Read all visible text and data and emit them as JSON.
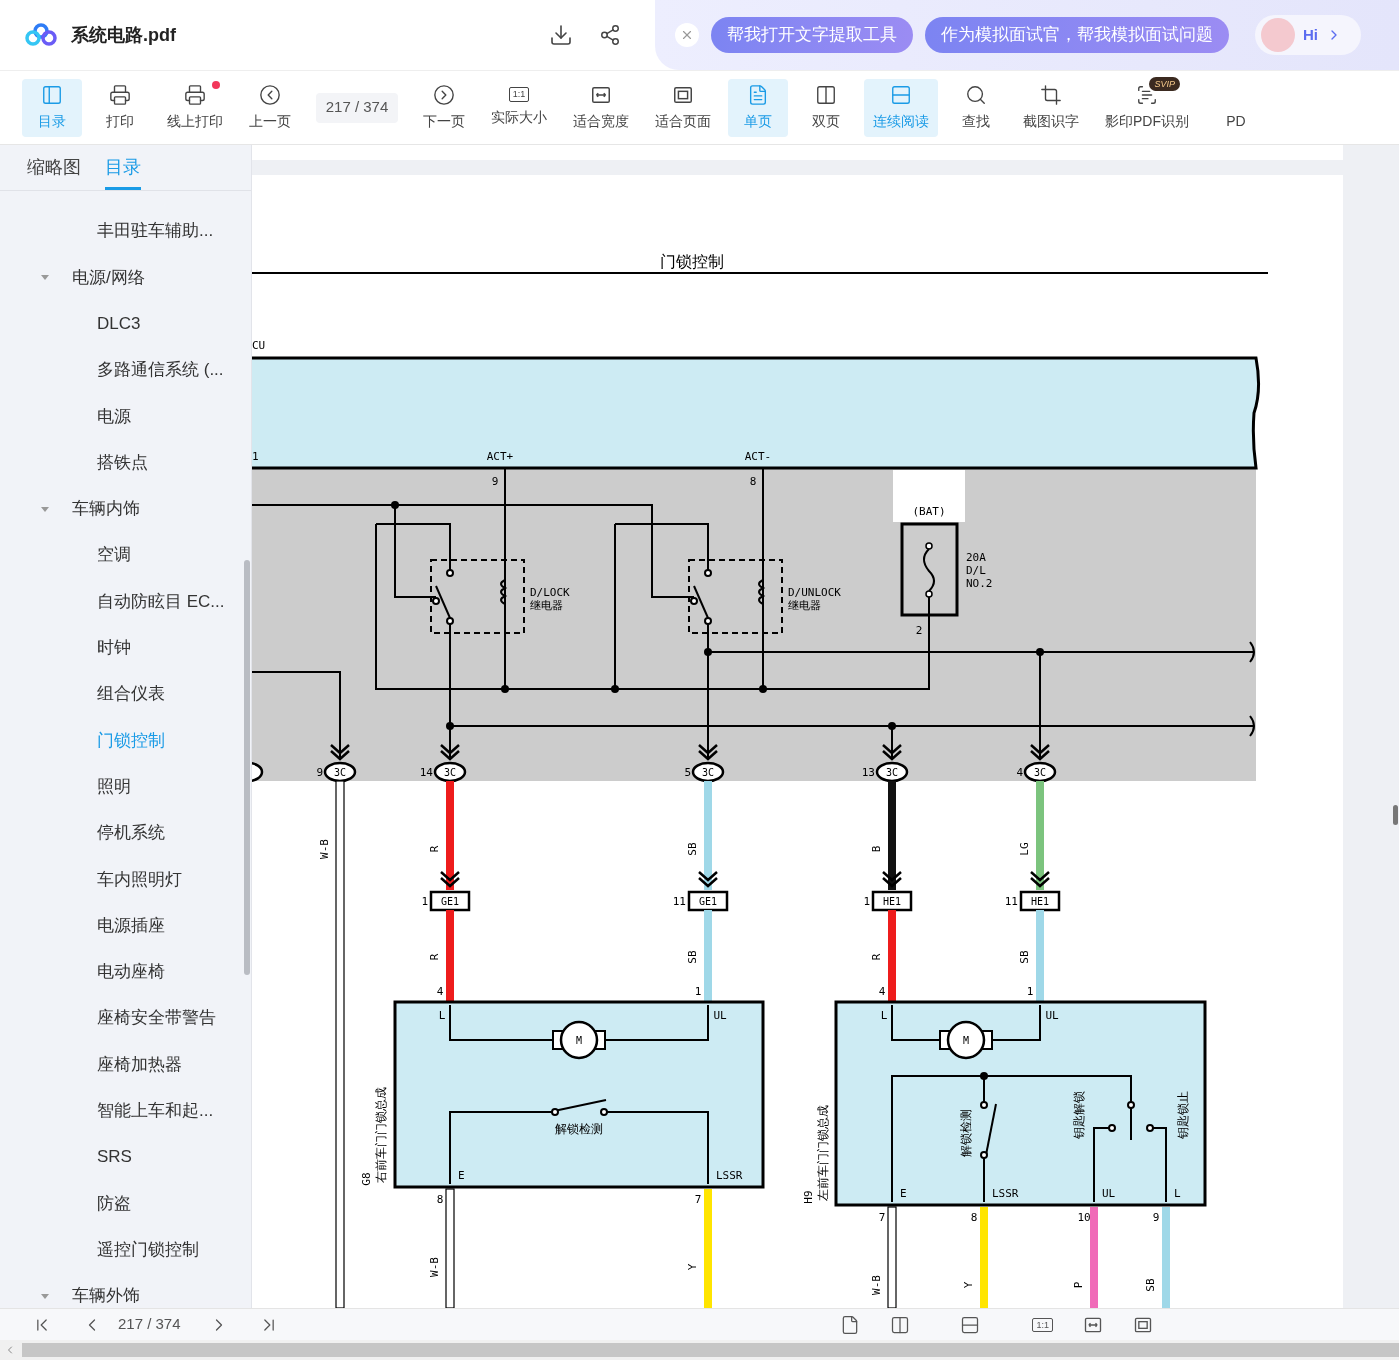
{
  "header": {
    "file_name": "系统电路.pdf",
    "suggestions": [
      "帮我打开文字提取工具",
      "作为模拟面试官，帮我模拟面试问题"
    ],
    "assistant": "Hi"
  },
  "toolbar": [
    {
      "kind": "button",
      "label": "目录",
      "selected": true,
      "notify": false
    },
    {
      "kind": "button",
      "label": "打印",
      "selected": false,
      "notify": false
    },
    {
      "kind": "button",
      "label": "线上打印",
      "selected": false,
      "notify": true
    },
    {
      "kind": "button",
      "label": "上一页",
      "selected": false,
      "notify": false
    },
    {
      "kind": "page_field",
      "value": "217 / 374"
    },
    {
      "kind": "button",
      "label": "下一页",
      "selected": false,
      "notify": false
    },
    {
      "kind": "button",
      "label": "实际大小",
      "icon_text": "1:1",
      "selected": false,
      "notify": false
    },
    {
      "kind": "button",
      "label": "适合宽度",
      "selected": false,
      "notify": false
    },
    {
      "kind": "button",
      "label": "适合页面",
      "selected": false,
      "notify": false
    },
    {
      "kind": "button",
      "label": "单页",
      "selected": true,
      "notify": false
    },
    {
      "kind": "button",
      "label": "双页",
      "selected": false,
      "notify": false
    },
    {
      "kind": "button",
      "label": "连续阅读",
      "selected": true,
      "notify": false
    },
    {
      "kind": "button",
      "label": "查找",
      "selected": false,
      "notify": false
    },
    {
      "kind": "button",
      "label": "截图识字",
      "selected": false,
      "notify": false
    },
    {
      "kind": "button",
      "label": "影印PDF识别",
      "badge": "SVIP",
      "selected": false,
      "notify": false
    },
    {
      "kind": "button",
      "label": "PD",
      "selected": false,
      "notify": false
    }
  ],
  "sidebar": {
    "tabs": [
      {
        "label": "缩略图",
        "selected": false
      },
      {
        "label": "目录",
        "selected": true
      }
    ],
    "outline": [
      {
        "children": [
          {
            "label": "丰田驻车辅助...",
            "selected": false
          }
        ]
      },
      {
        "label": "电源/网络",
        "expanded": true,
        "selected": false,
        "children": [
          {
            "label": "DLC3",
            "selected": false
          },
          {
            "label": "多路通信系统 (...",
            "selected": false
          },
          {
            "label": "电源",
            "selected": false
          },
          {
            "label": "搭铁点",
            "selected": false
          }
        ]
      },
      {
        "label": "车辆内饰",
        "expanded": true,
        "selected": false,
        "children": [
          {
            "label": "空调",
            "selected": false
          },
          {
            "label": "自动防眩目 EC...",
            "selected": false
          },
          {
            "label": "时钟",
            "selected": false
          },
          {
            "label": "组合仪表",
            "selected": false
          },
          {
            "label": "门锁控制",
            "selected": true
          },
          {
            "label": "照明",
            "selected": false
          },
          {
            "label": "停机系统",
            "selected": false
          },
          {
            "label": "车内照明灯",
            "selected": false
          },
          {
            "label": "电源插座",
            "selected": false
          },
          {
            "label": "电动座椅",
            "selected": false
          },
          {
            "label": "座椅安全带警告",
            "selected": false
          },
          {
            "label": "座椅加热器",
            "selected": false
          },
          {
            "label": "智能上车和起...",
            "selected": false
          },
          {
            "label": "SRS",
            "selected": false
          },
          {
            "label": "防盗",
            "selected": false
          },
          {
            "label": "遥控门锁控制",
            "selected": false
          }
        ]
      },
      {
        "label": "车辆外饰",
        "expanded": true,
        "selected": false
      }
    ]
  },
  "diagram": {
    "title": "门锁控制",
    "ecu_label": "CU",
    "edge_pin": "1",
    "ecu_pins": [
      {
        "name": "ACT+",
        "number": "9"
      },
      {
        "name": "ACT-",
        "number": "8"
      }
    ],
    "relays": [
      {
        "name": "D/LOCK",
        "type": "继电器"
      },
      {
        "name": "D/UNLOCK",
        "type": "继电器"
      }
    ],
    "fuse": {
      "source": "(BAT)",
      "lines": [
        "20A",
        "D/L",
        "NO.2"
      ],
      "pin": "2"
    },
    "ecu_connectors": [
      {
        "pin": "9",
        "code": "3C"
      },
      {
        "pin": "14",
        "code": "3C"
      },
      {
        "pin": "5",
        "code": "3C"
      },
      {
        "pin": "13",
        "code": "3C"
      },
      {
        "pin": "4",
        "code": "3C"
      }
    ],
    "upper_wires": [
      {
        "label": "W-B",
        "color": "#ffffff"
      },
      {
        "label": "R",
        "color": "#ee1c1c"
      },
      {
        "label": "SB",
        "color": "#9fd8e8"
      },
      {
        "label": "B",
        "color": "#111111"
      },
      {
        "label": "LG",
        "color": "#7cc47e"
      }
    ],
    "inline_connectors": [
      {
        "pin": "1",
        "code": "GE1"
      },
      {
        "pin": "11",
        "code": "GE1"
      },
      {
        "pin": "1",
        "code": "HE1"
      },
      {
        "pin": "11",
        "code": "HE1"
      }
    ],
    "middle_wires": [
      {
        "label": "R",
        "color": "#ee1c1c"
      },
      {
        "label": "SB",
        "color": "#9fd8e8"
      },
      {
        "label": "R",
        "color": "#ee1c1c"
      },
      {
        "label": "SB",
        "color": "#9fd8e8"
      }
    ],
    "assemblies": [
      {
        "code": "G8",
        "name": "右前车门门锁总成",
        "motor": "M",
        "top_pins": [
          {
            "terminal": "L",
            "number": "4"
          },
          {
            "terminal": "UL",
            "number": "1"
          }
        ],
        "switches": [
          "解锁检测"
        ],
        "bottom_pins": [
          {
            "terminal": "E",
            "number": "8",
            "wire": "W-B",
            "color": "#ffffff"
          },
          {
            "terminal": "LSSR",
            "number": "7",
            "wire": "Y",
            "color": "#ffe500"
          }
        ]
      },
      {
        "code": "H9",
        "name": "左前车门门锁总成",
        "motor": "M",
        "top_pins": [
          {
            "terminal": "L",
            "number": "4"
          },
          {
            "terminal": "UL",
            "number": "1"
          }
        ],
        "switches": [
          "解锁检测",
          "钥匙解锁",
          "钥匙锁止"
        ],
        "bottom_pins": [
          {
            "terminal": "E",
            "number": "7",
            "wire": "W-B",
            "color": "#ffffff"
          },
          {
            "terminal": "LSSR",
            "number": "8",
            "wire": "Y",
            "color": "#ffe500"
          },
          {
            "terminal": "UL",
            "number": "10",
            "wire": "P",
            "color": "#f06bb8"
          },
          {
            "terminal": "L",
            "number": "9",
            "wire": "SB",
            "color": "#9fd8e8"
          }
        ]
      }
    ]
  },
  "statusbar": {
    "page": "217 / 374",
    "zoom_icon_text": "1:1"
  }
}
